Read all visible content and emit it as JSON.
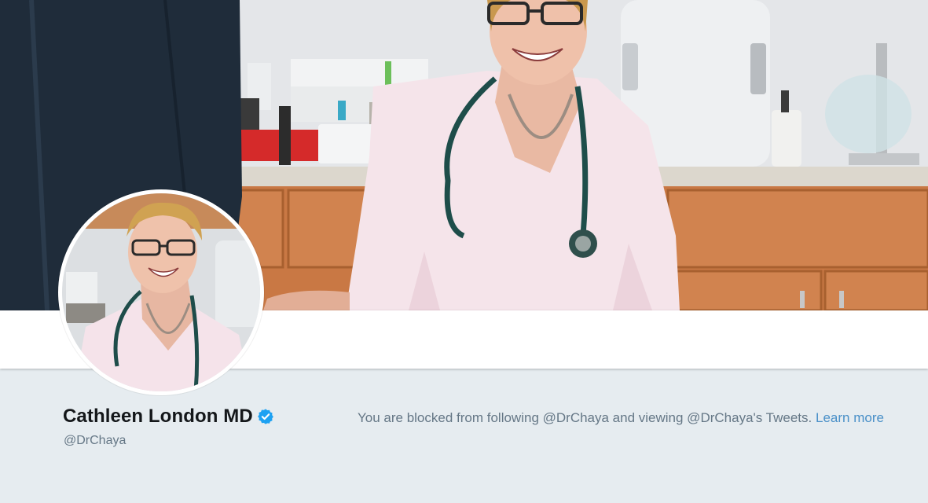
{
  "profile": {
    "name": "Cathleen London MD",
    "handle": "@DrChaya",
    "verified": true,
    "verified_icon": "verified-badge-icon"
  },
  "blocked": {
    "message": "You are blocked from following @DrChaya and viewing @DrChaya's Tweets.",
    "learn_more_label": "Learn more"
  },
  "colors": {
    "page_background": "#e6ecf0",
    "name_text": "#14171a",
    "secondary_text": "#657786",
    "link": "#4a90c8",
    "verified_blue": "#1da1f2"
  }
}
